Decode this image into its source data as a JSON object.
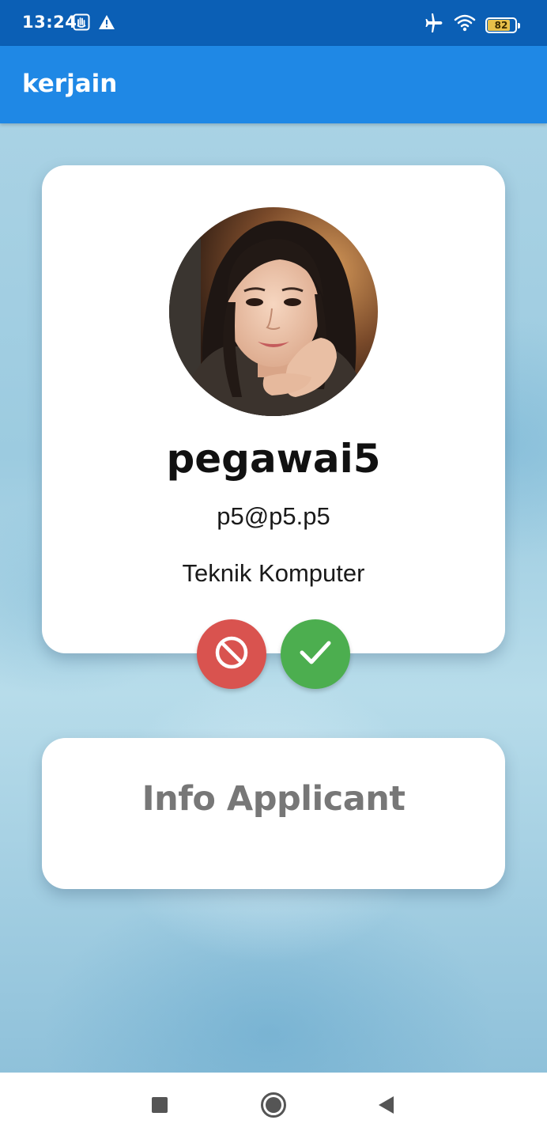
{
  "status_bar": {
    "time": "13:24",
    "battery_level": "82",
    "battery_fraction": 0.82,
    "icons": [
      "hand-icon",
      "warning-icon",
      "airplane-icon",
      "wifi-icon",
      "battery-icon"
    ]
  },
  "app_bar": {
    "title": "kerjain",
    "color": "#1f88e5"
  },
  "profile": {
    "name": "pegawai5",
    "email": "p5@p5.p5",
    "major": "Teknik Komputer"
  },
  "actions": {
    "reject_color": "#d9534f",
    "accept_color": "#4cae4f",
    "reject_icon": "block-icon",
    "accept_icon": "check-icon"
  },
  "info_card": {
    "title": "Info Applicant"
  },
  "nav_bar": {
    "buttons": [
      "recents-icon",
      "home-icon",
      "back-icon"
    ]
  }
}
